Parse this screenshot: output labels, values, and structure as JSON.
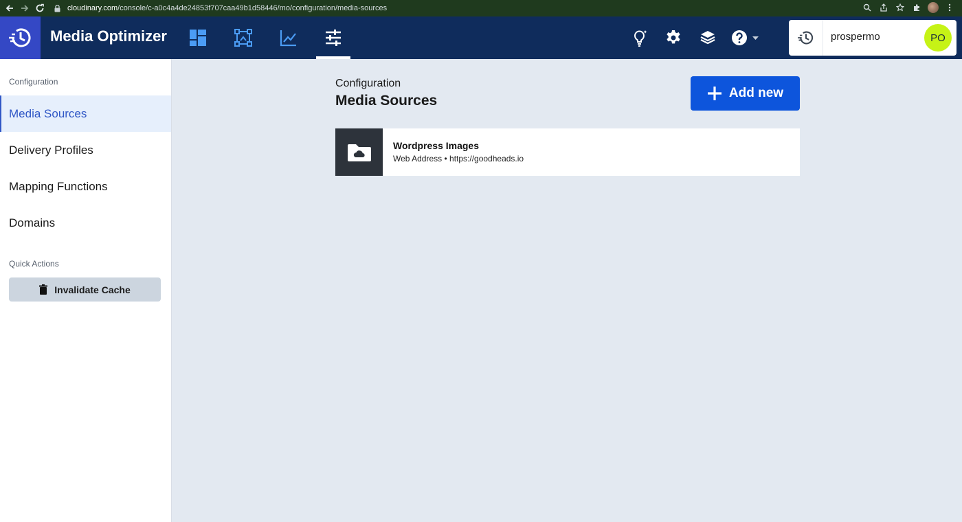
{
  "browser": {
    "url_host": "cloudinary.com",
    "url_path": "/console/c-a0c4a4de24853f707caa49b1d58446/mo/configuration/media-sources",
    "icons": [
      "back-arrow-icon",
      "forward-arrow-icon",
      "reload-icon",
      "lock-icon",
      "zoom-icon",
      "share-icon",
      "star-icon",
      "extensions-icon",
      "profile-icon",
      "menu-dots-icon"
    ]
  },
  "header": {
    "title": "Media Optimizer",
    "nav_icons": [
      "dashboard-icon",
      "transform-icon",
      "analytics-icon",
      "configuration-icon"
    ],
    "active_tab": "configuration",
    "right_icons": [
      "tips-icon",
      "settings-icon",
      "academy-icon",
      "help-icon"
    ],
    "user": {
      "name": "prospermo",
      "initials": "PO",
      "avatar_color": "#c6f316"
    }
  },
  "sidebar": {
    "section1": "Configuration",
    "items": [
      {
        "label": "Media Sources",
        "active": true
      },
      {
        "label": "Delivery Profiles",
        "active": false
      },
      {
        "label": "Mapping Functions",
        "active": false
      },
      {
        "label": "Domains",
        "active": false
      }
    ],
    "section2": "Quick Actions",
    "invalidate_label": "Invalidate Cache"
  },
  "main": {
    "breadcrumb": "Configuration",
    "title": "Media Sources",
    "add_label": "Add new",
    "sources": [
      {
        "name": "Wordpress Images",
        "meta": "Web Address • https://goodheads.io",
        "icon": "cloud-folder-icon"
      }
    ]
  },
  "colors": {
    "header_bg": "#0f2c5c",
    "logo_bg": "#3448c5",
    "primary": "#0d55dc",
    "active_nav": "#3057c6",
    "main_bg": "#e3e9f1"
  }
}
